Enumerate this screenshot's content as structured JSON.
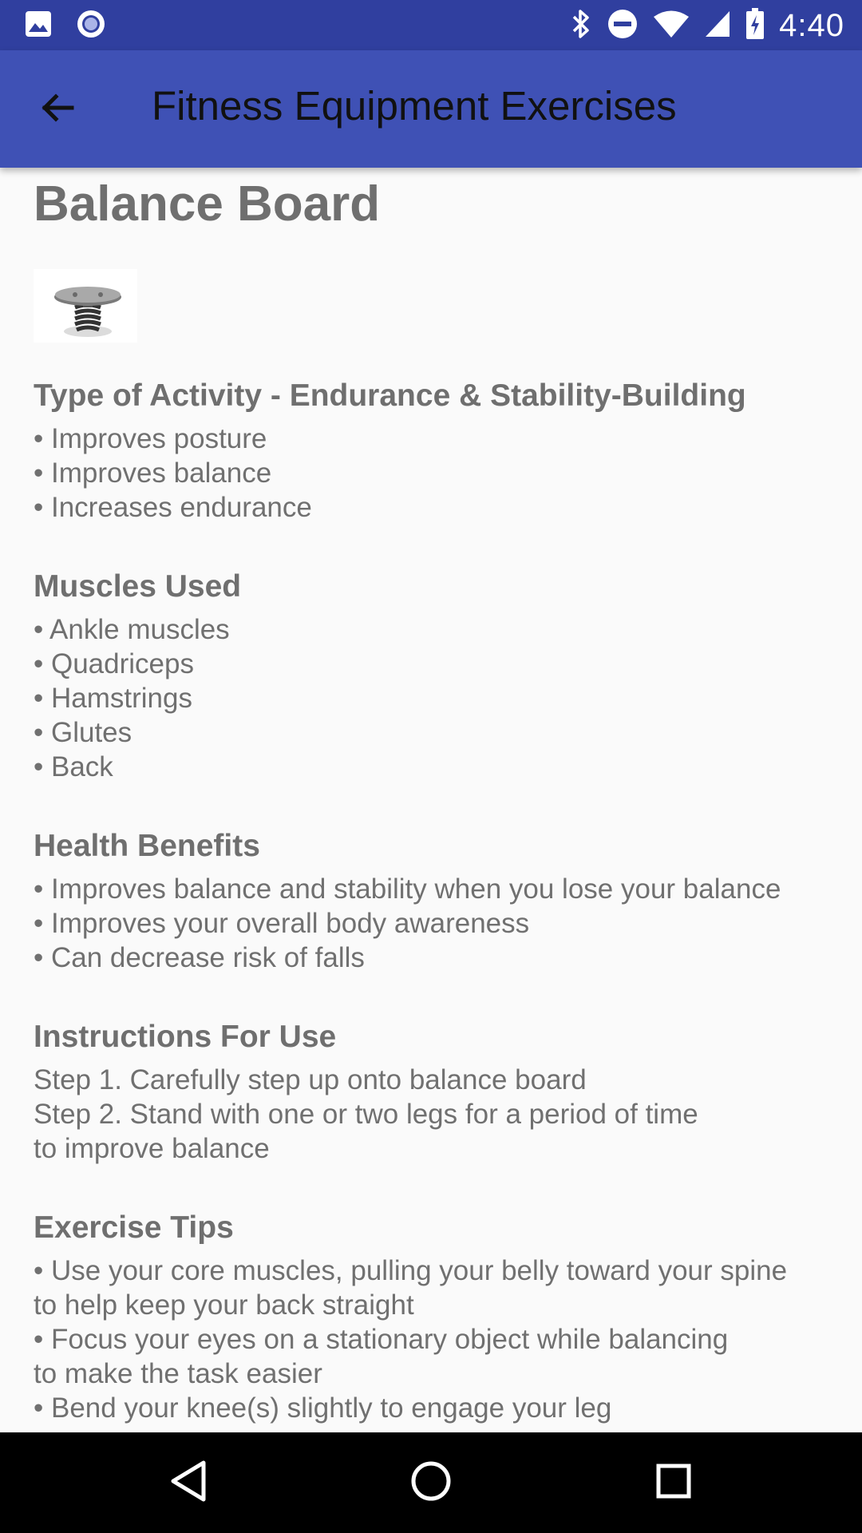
{
  "status_bar": {
    "time": "4:40",
    "left_icons": [
      "image-icon",
      "circle-dot-icon"
    ],
    "right_icons": [
      "bluetooth-icon",
      "do-not-disturb-icon",
      "wifi-icon",
      "cell-signal-icon",
      "battery-charging-icon"
    ]
  },
  "app_bar": {
    "title": "Fitness Equipment Exercises"
  },
  "page": {
    "title": "Balance Board"
  },
  "sections": {
    "activity": {
      "heading": "Type of Activity  -  Endurance & Stability-Building",
      "lines": [
        "• Improves posture",
        "• Improves balance",
        "• Increases endurance"
      ]
    },
    "muscles": {
      "heading": "Muscles Used",
      "lines": [
        "• Ankle muscles",
        "• Quadriceps",
        "• Hamstrings",
        "• Glutes",
        "• Back"
      ]
    },
    "benefits": {
      "heading": "Health Benefits",
      "lines": [
        "• Improves balance and stability when you lose your balance",
        "• Improves your overall body awareness",
        "• Can decrease risk of falls"
      ]
    },
    "instructions": {
      "heading": "Instructions For Use",
      "lines": [
        "Step 1. Carefully step up onto balance board",
        "Step 2. Stand with one or two legs for a period of time",
        "to improve balance"
      ]
    },
    "tips": {
      "heading": "Exercise Tips",
      "lines": [
        "• Use your core muscles, pulling your belly toward your spine",
        "to help keep your back straight",
        "• Focus your eyes on a stationary object while balancing",
        "to make the task easier",
        "• Bend your knee(s) slightly to engage your leg"
      ]
    }
  },
  "nav_bar": {
    "icons": [
      "back-triangle-icon",
      "home-circle-icon",
      "recents-square-icon"
    ]
  }
}
